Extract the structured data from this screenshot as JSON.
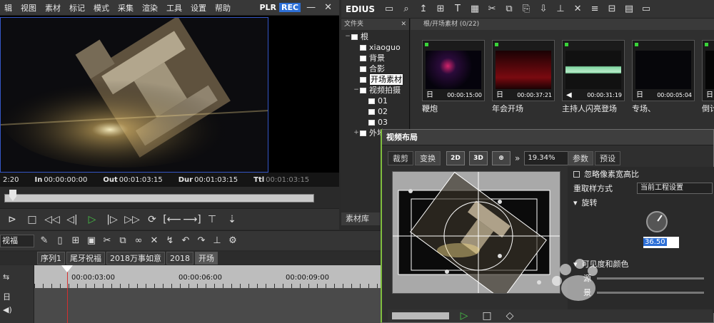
{
  "player": {
    "menu": [
      "辑",
      "视图",
      "素材",
      "标记",
      "模式",
      "采集",
      "渲染",
      "工具",
      "设置",
      "帮助"
    ],
    "plr_label": "PLR",
    "rec_label": "REC",
    "timecodes": {
      "start_prefix": "2:20",
      "in_label": "In",
      "in_value": "00:00:00:00",
      "out_label": "Out",
      "out_value": "00:01:03:15",
      "dur_label": "Dur",
      "dur_value": "00:01:03:15",
      "ttl_label": "Ttl",
      "ttl_value": "00:01:03:15"
    },
    "scrub_position": 0.02
  },
  "bin": {
    "app_name": "EDIUS",
    "folder_header": "文件夹",
    "tree": [
      {
        "label": "根",
        "depth": 0,
        "exp": "−"
      },
      {
        "label": "xiaoguo",
        "depth": 1,
        "exp": ""
      },
      {
        "label": "背景",
        "depth": 1,
        "exp": ""
      },
      {
        "label": "合影",
        "depth": 1,
        "exp": ""
      },
      {
        "label": "开场素材",
        "depth": 1,
        "exp": "",
        "selected": true
      },
      {
        "label": "视频拍摄",
        "depth": 1,
        "exp": "−"
      },
      {
        "label": "01",
        "depth": 2,
        "exp": ""
      },
      {
        "label": "02",
        "depth": 2,
        "exp": ""
      },
      {
        "label": "03",
        "depth": 2,
        "exp": ""
      },
      {
        "label": "外地",
        "depth": 1,
        "exp": "+"
      }
    ],
    "bin_tab": "素材库",
    "clips_header": "根/开场素材 (0/22)",
    "clips": [
      {
        "name": "鞭炮",
        "time": "00:00:15:00",
        "icon": "film-icon"
      },
      {
        "name": "年会开场",
        "time": "00:00:37:21",
        "icon": "film-icon"
      },
      {
        "name": "主持人闪亮登场",
        "time": "00:00:31:19",
        "icon": "audio-icon"
      },
      {
        "name": "专场、",
        "time": "00:00:05:04",
        "icon": "film-icon"
      },
      {
        "name": "倒计",
        "time": "",
        "icon": "film-icon"
      }
    ]
  },
  "timeline": {
    "track_label": "视福",
    "seq_tabs": [
      "序列1",
      "尾牙祝福",
      "2018万事如意",
      "2018",
      "开场"
    ],
    "active_tab": 4,
    "ruler_labels": [
      "00:00:03:00",
      "00:00:06:00",
      "00:00:09:00"
    ]
  },
  "dialog": {
    "title": "视频布局",
    "tabs": [
      "裁剪",
      "变换"
    ],
    "active_tab": 1,
    "tool_2d": "2D",
    "tool_3d": "3D",
    "zoom": "19.34%",
    "param_tabs": [
      "参数",
      "预设"
    ],
    "params": {
      "ignore_aspect": "忽略像素宽高比",
      "resample_label": "重取样方式",
      "resample_value": "当前工程设置",
      "rotation_label": "旋转",
      "rotation_value": "36.50",
      "visible_label": "可见度和颜色",
      "src_label": "源",
      "bottom_label": "景"
    }
  },
  "colors": {
    "accent": "#2d6fd6",
    "play_green": "#46c346",
    "dialog_border": "#7fbd3e",
    "playhead": "#d43030"
  }
}
